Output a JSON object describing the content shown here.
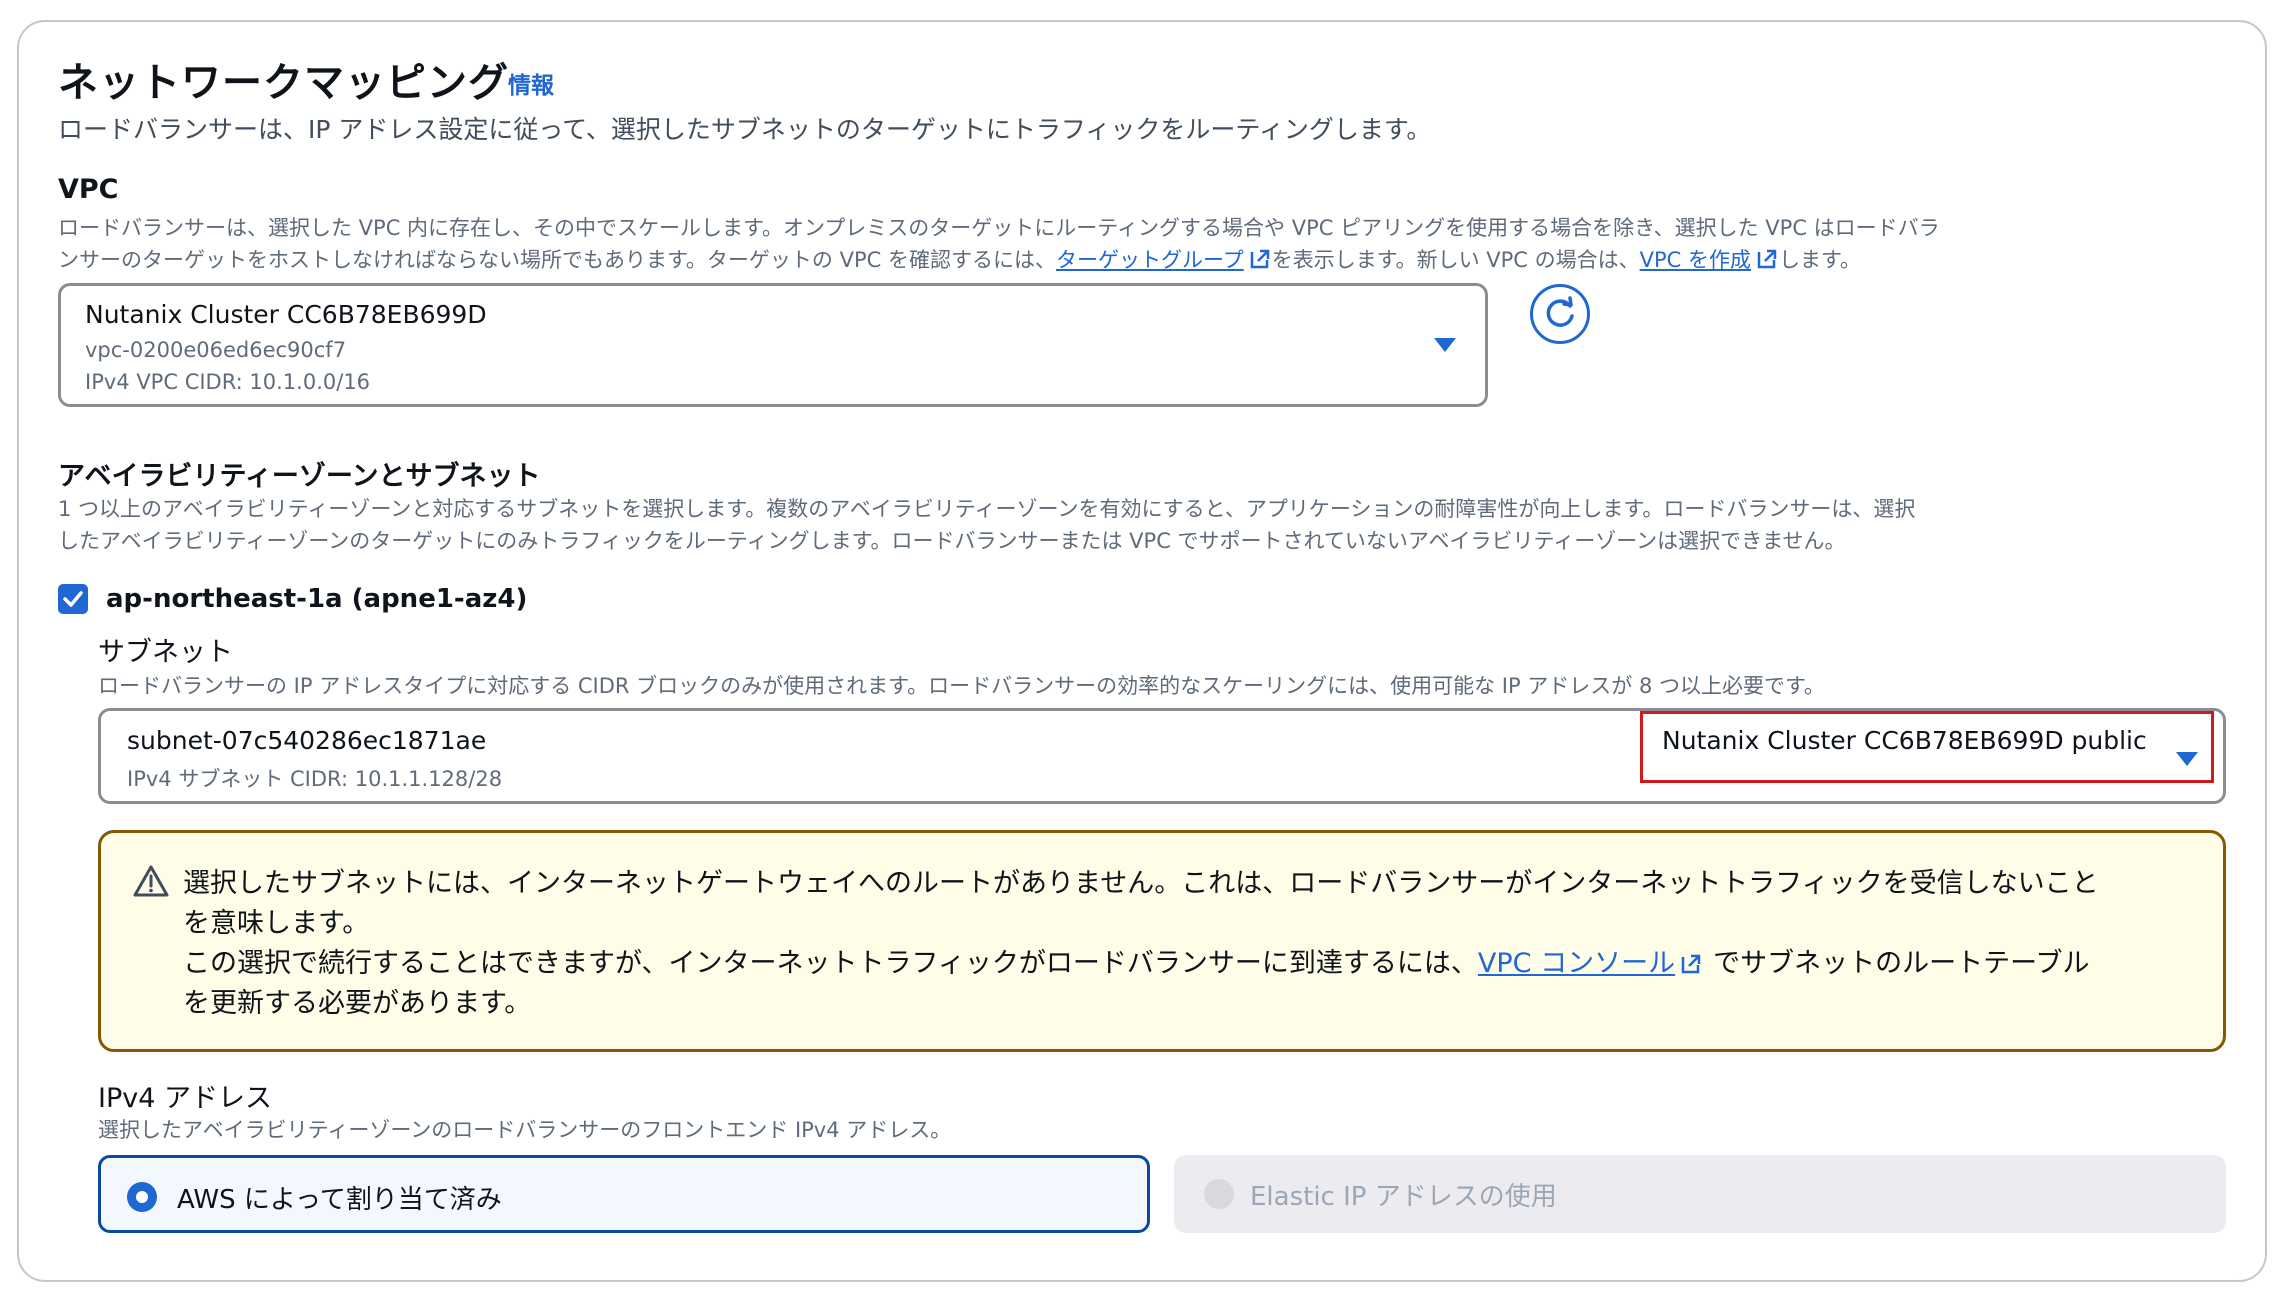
{
  "section": {
    "title": "ネットワークマッピング",
    "info_link": "情報",
    "description": "ロードバランサーは、IP アドレス設定に従って、選択したサブネットのターゲットにトラフィックをルーティングします。"
  },
  "vpc": {
    "heading": "VPC",
    "desc_line1": "ロードバランサーは、選択した VPC 内に存在し、その中でスケールします。オンプレミスのターゲットにルーティングする場合や VPC ピアリングを使用する場合を除き、選択した VPC はロードバラ",
    "desc_line2_a": "ンサーのターゲットをホストしなければならない場所でもあります。ターゲットの VPC を確認するには、",
    "target_group_link": "ターゲットグループ",
    "desc_line2_b": "を表示します。新しい VPC の場合は、",
    "create_vpc_link": "VPC を作成",
    "desc_line2_c": "します。",
    "selected_name": "Nutanix Cluster CC6B78EB699D",
    "selected_id": "vpc-0200e06ed6ec90cf7",
    "selected_cidr": "IPv4 VPC CIDR: 10.1.0.0/16"
  },
  "az": {
    "heading": "アベイラビリティーゾーンとサブネット",
    "desc_line1": "1 つ以上のアベイラビリティーゾーンと対応するサブネットを選択します。複数のアベイラビリティーゾーンを有効にすると、アプリケーションの耐障害性が向上します。ロードバランサーは、選択",
    "desc_line2": "したアベイラビリティーゾーンのターゲットにのみトラフィックをルーティングします。ロードバランサーまたは VPC でサポートされていないアベイラビリティーゾーンは選択できません。",
    "zone_label": "ap-northeast-1a (apne1-az4)",
    "zone_checked": true
  },
  "subnet": {
    "heading": "サブネット",
    "description": "ロードバランサーの IP アドレスタイプに対応する CIDR ブロックのみが使用されます。ロードバランサーの効率的なスケーリングには、使用可能な IP アドレスが 8 つ以上必要です。",
    "selected_id": "subnet-07c540286ec1871ae",
    "selected_cidr": "IPv4 サブネット CIDR: 10.1.1.128/28",
    "selected_name": "Nutanix Cluster CC6B78EB699D public"
  },
  "warning": {
    "line1": "選択したサブネットには、インターネットゲートウェイへのルートがありません。これは、ロードバランサーがインターネットトラフィックを受信しないこと",
    "line2": "を意味します。",
    "line3_a": "この選択で続行することはできますが、インターネットトラフィックがロードバランサーに到達するには、",
    "vpc_console_link": "VPC コンソール",
    "line3_b": "でサブネットのルートテーブル",
    "line4": "を更新する必要があります。"
  },
  "ipv4": {
    "heading": "IPv4 アドレス",
    "description": "選択したアベイラビリティーゾーンのロードバランサーのフロントエンド IPv4 アドレス。",
    "option_aws": "AWS によって割り当て済み",
    "option_elastic": "Elastic IP アドレスの使用"
  },
  "colors": {
    "link": "#1f67d2",
    "highlight": "#d11919",
    "warning_border": "#855900",
    "warning_bg": "#fffce8"
  },
  "icons": [
    "external-link-icon",
    "refresh-icon",
    "checkmark-icon",
    "warning-icon",
    "caret-down-icon"
  ]
}
